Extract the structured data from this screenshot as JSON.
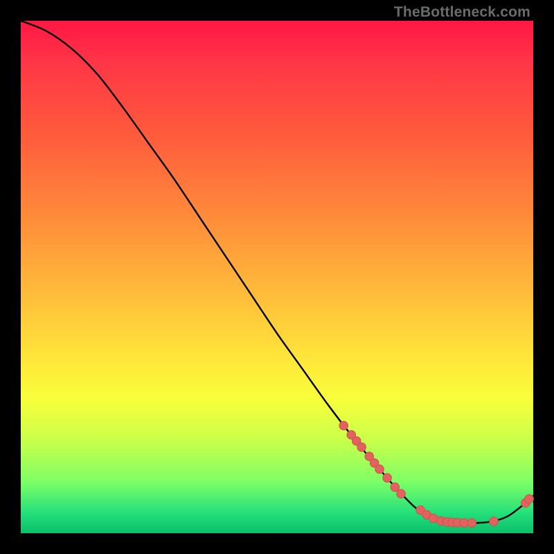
{
  "watermark": "TheBottleneck.com",
  "colors": {
    "background": "#000000",
    "curve_stroke": "#000000",
    "marker_fill": "#e2635e",
    "marker_stroke": "#c9534f"
  },
  "chart_data": {
    "type": "line",
    "title": "",
    "xlabel": "",
    "ylabel": "",
    "xlim": [
      0,
      100
    ],
    "ylim": [
      0,
      100
    ],
    "grid": false,
    "legend": false,
    "curve": {
      "comment": "x,y pairs in percent of plot area, y=0 is bottom",
      "points": [
        [
          0,
          100
        ],
        [
          5,
          98
        ],
        [
          10,
          94.5
        ],
        [
          15,
          89.5
        ],
        [
          20,
          83
        ],
        [
          25,
          76
        ],
        [
          30,
          69
        ],
        [
          35,
          61.5
        ],
        [
          40,
          54
        ],
        [
          45,
          46.5
        ],
        [
          50,
          39
        ],
        [
          55,
          32
        ],
        [
          60,
          25
        ],
        [
          65,
          18.5
        ],
        [
          70,
          12.5
        ],
        [
          74,
          8
        ],
        [
          77,
          5
        ],
        [
          80,
          3
        ],
        [
          83,
          2.2
        ],
        [
          86,
          2
        ],
        [
          89,
          2
        ],
        [
          92,
          2.3
        ],
        [
          95,
          3.3
        ],
        [
          98,
          5.5
        ],
        [
          100,
          7.3
        ]
      ]
    },
    "markers": {
      "comment": "highlighted sample dots along the curve (lower-right cluster)",
      "points": [
        [
          63,
          21
        ],
        [
          64.5,
          19.2
        ],
        [
          65.5,
          18
        ],
        [
          66.5,
          16.8
        ],
        [
          68,
          15
        ],
        [
          69,
          13.7
        ],
        [
          70,
          12.5
        ],
        [
          71.5,
          10.8
        ],
        [
          73,
          9
        ],
        [
          74.2,
          7.7
        ],
        [
          78,
          4.5
        ],
        [
          79.2,
          3.6
        ],
        [
          80.5,
          2.9
        ],
        [
          82,
          2.4
        ],
        [
          83.2,
          2.2
        ],
        [
          84.2,
          2.1
        ],
        [
          85.2,
          2.05
        ],
        [
          86.5,
          2
        ],
        [
          88,
          2
        ],
        [
          92.3,
          2.3
        ],
        [
          98.5,
          5.9
        ],
        [
          99.2,
          6.7
        ]
      ]
    }
  }
}
